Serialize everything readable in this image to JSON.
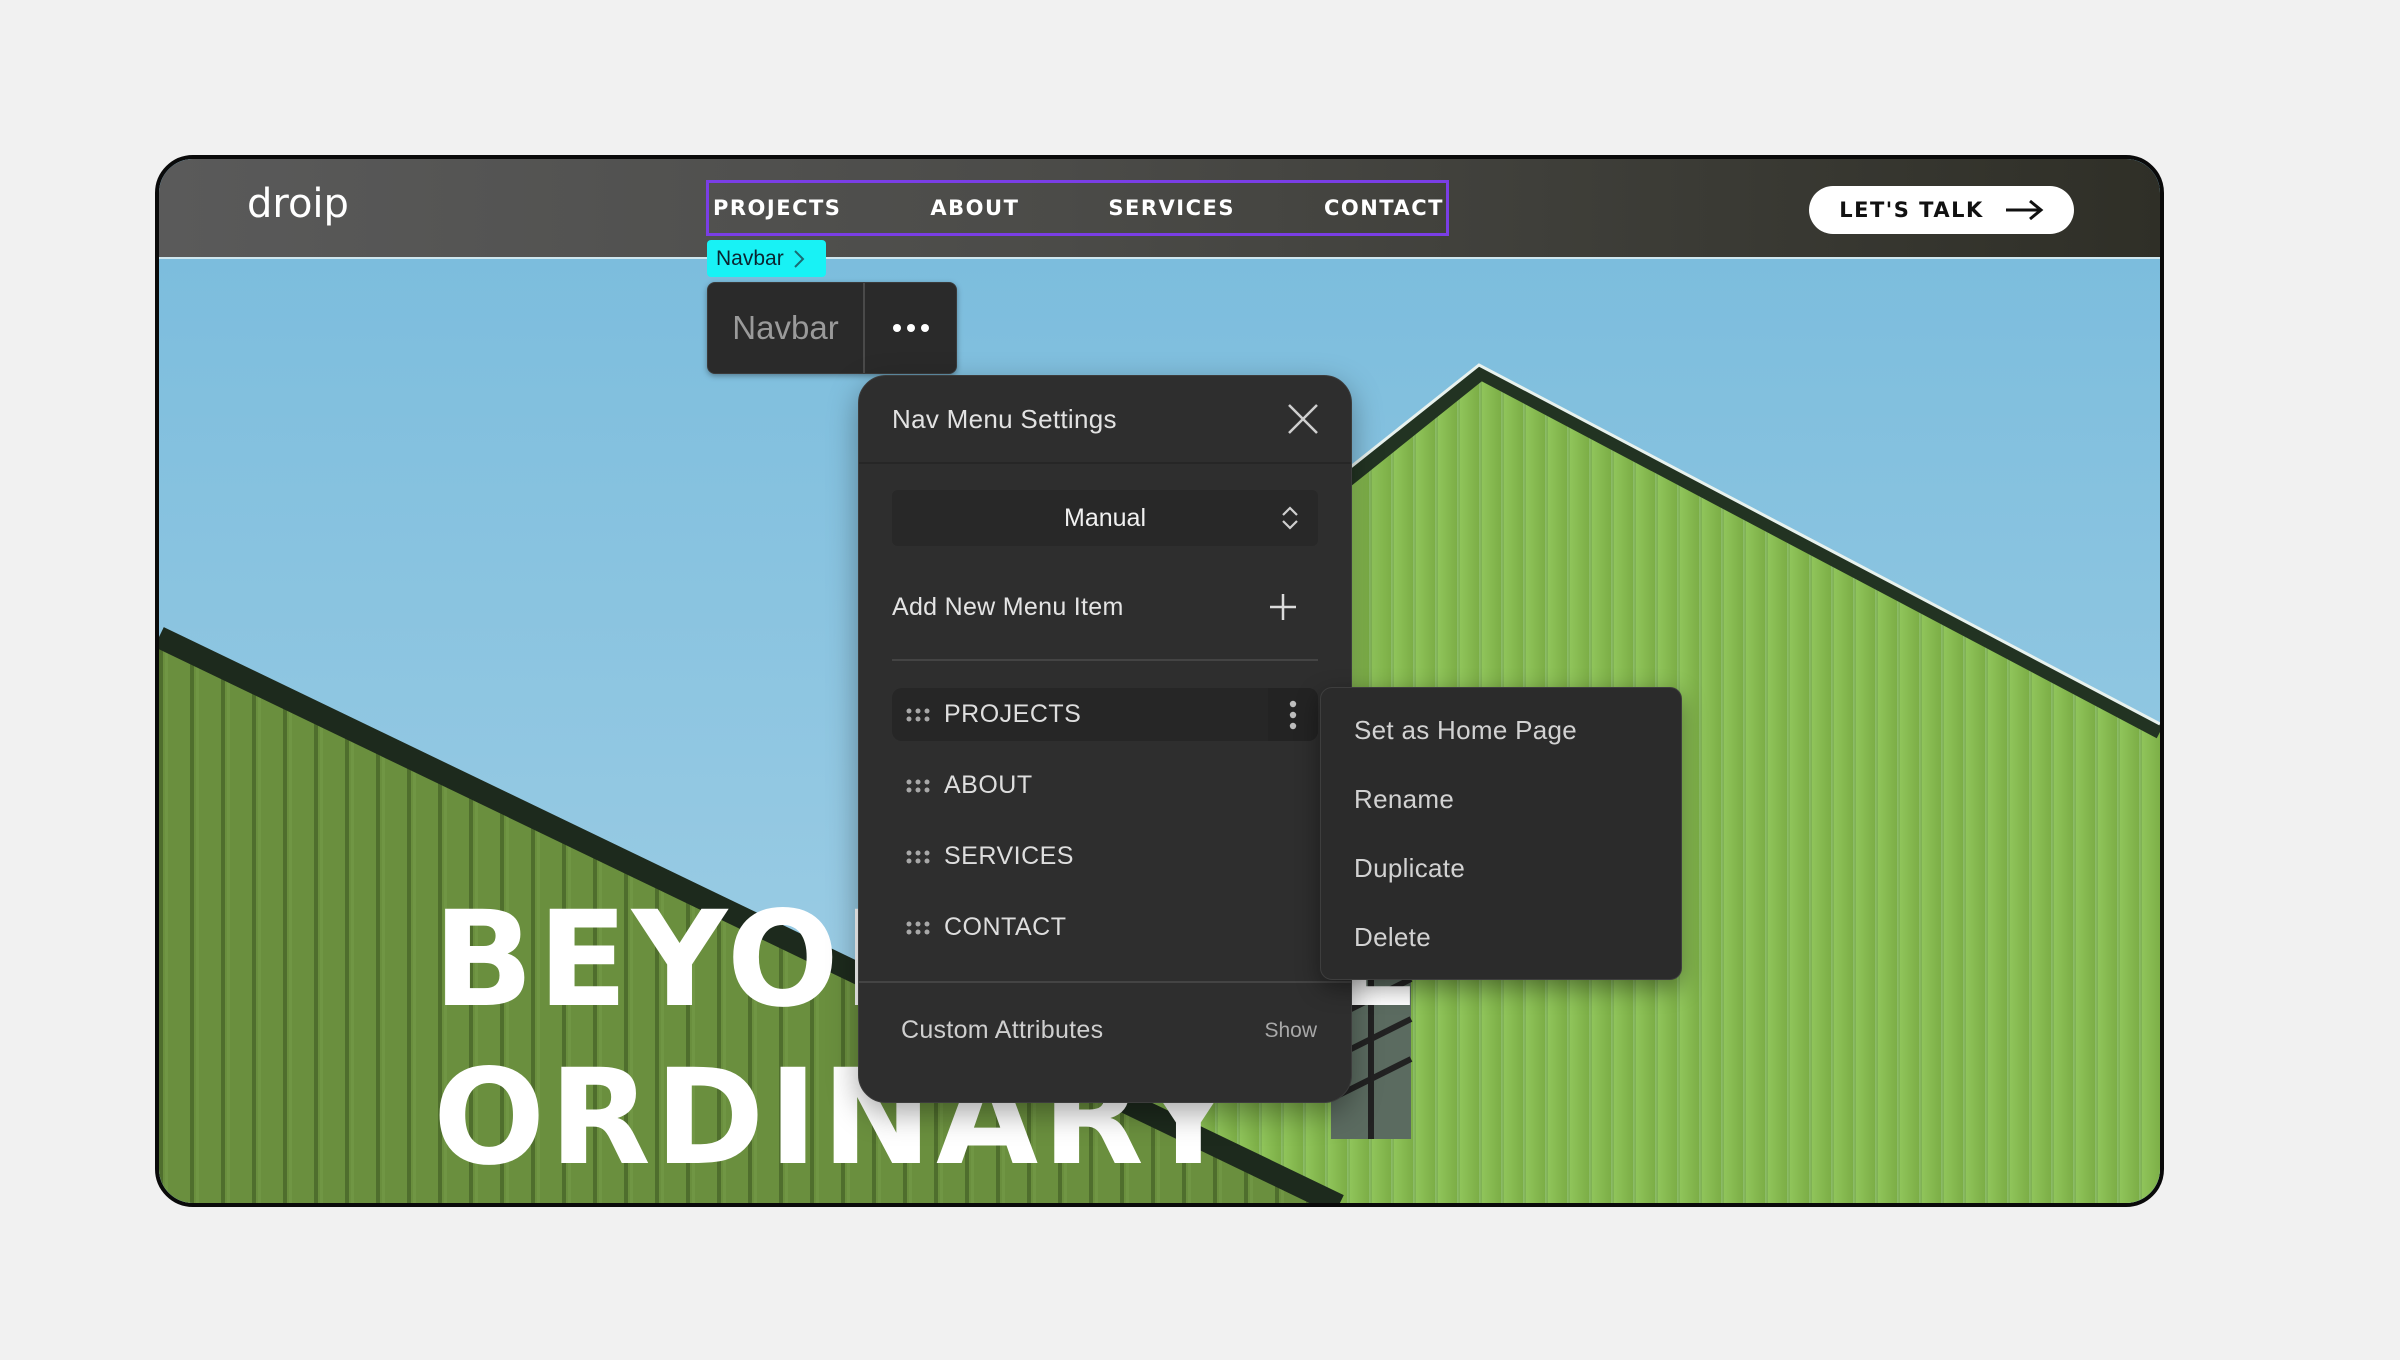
{
  "site": {
    "logo": "droip",
    "nav_links": [
      "PROJECTS",
      "ABOUT",
      "SERVICES",
      "CONTACT"
    ],
    "cta_label": "LET'S TALK",
    "hero_line1": "BEYOND THE",
    "hero_line2": "ORDINARY"
  },
  "editor": {
    "selected_tag": "Navbar",
    "element_name": "Navbar",
    "selection_color": "#7a3ee6",
    "tag_color": "#18f2f5"
  },
  "panel": {
    "title": "Nav Menu Settings",
    "mode_select": "Manual",
    "add_label": "Add New Menu Item",
    "items": [
      {
        "label": "PROJECTS",
        "active": true
      },
      {
        "label": "ABOUT",
        "active": false
      },
      {
        "label": "SERVICES",
        "active": false
      },
      {
        "label": "CONTACT",
        "active": false
      }
    ],
    "custom_attributes_label": "Custom Attributes",
    "custom_attributes_toggle": "Show"
  },
  "context_menu": {
    "items": [
      "Set as Home Page",
      "Rename",
      "Duplicate",
      "Delete"
    ]
  }
}
